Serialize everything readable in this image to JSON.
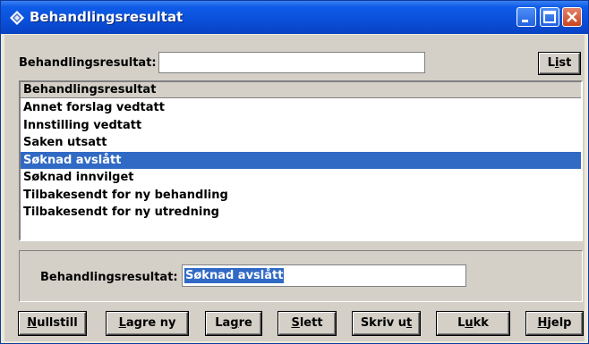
{
  "window": {
    "title": "Behandlingsresultat",
    "controls": [
      "minimize",
      "maximize",
      "close"
    ]
  },
  "search": {
    "label": "Behandlingsresultat:",
    "value": "",
    "list_button": {
      "pre": "L",
      "key": "i",
      "post": "st"
    }
  },
  "list": {
    "header": "Behandlingsresultat",
    "items": [
      "Annet forslag vedtatt",
      "Innstilling vedtatt",
      "Saken utsatt",
      "Søknad avslått",
      "Søknad innvilget",
      "Tilbakesendt for ny behandling",
      "Tilbakesendt for ny utredning"
    ],
    "selected_index": 3
  },
  "detail": {
    "label": "Behandlingsresultat:",
    "value": "Søknad avslått"
  },
  "buttons": {
    "nullstill": {
      "pre": "",
      "key": "N",
      "post": "ullstill"
    },
    "lagre_ny": {
      "pre": "",
      "key": "L",
      "post": "agre ny"
    },
    "lagre": {
      "pre": "La",
      "key": "g",
      "post": "re"
    },
    "slett": {
      "pre": "",
      "key": "S",
      "post": "lett"
    },
    "skriv_ut": {
      "pre": "Skriv u",
      "key": "t",
      "post": ""
    },
    "lukk": {
      "pre": "L",
      "key": "u",
      "post": "kk"
    },
    "hjelp": {
      "pre": "",
      "key": "H",
      "post": "jelp"
    }
  },
  "colors": {
    "titlebar": "#0a4fd9",
    "selection": "#316ac5",
    "face": "#d4d0c8"
  }
}
